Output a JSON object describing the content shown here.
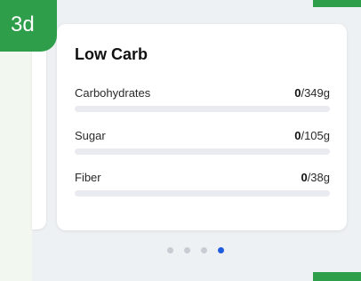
{
  "step": {
    "label": "3d"
  },
  "card": {
    "title": "Low Carb",
    "rows": [
      {
        "label": "Carbohydrates",
        "current": "0",
        "goal": "/349g",
        "fraction": 0
      },
      {
        "label": "Sugar",
        "current": "0",
        "goal": "/105g",
        "fraction": 0
      },
      {
        "label": "Fiber",
        "current": "0",
        "goal": "/38g",
        "fraction": 0
      }
    ]
  },
  "pagination": {
    "count": 4,
    "active_index": 3
  },
  "colors": {
    "accent_green": "#2f9e4a",
    "active_dot": "#1f5ce0",
    "inactive_dot": "#c9ccd2",
    "bar_track": "#e9ebf0"
  }
}
